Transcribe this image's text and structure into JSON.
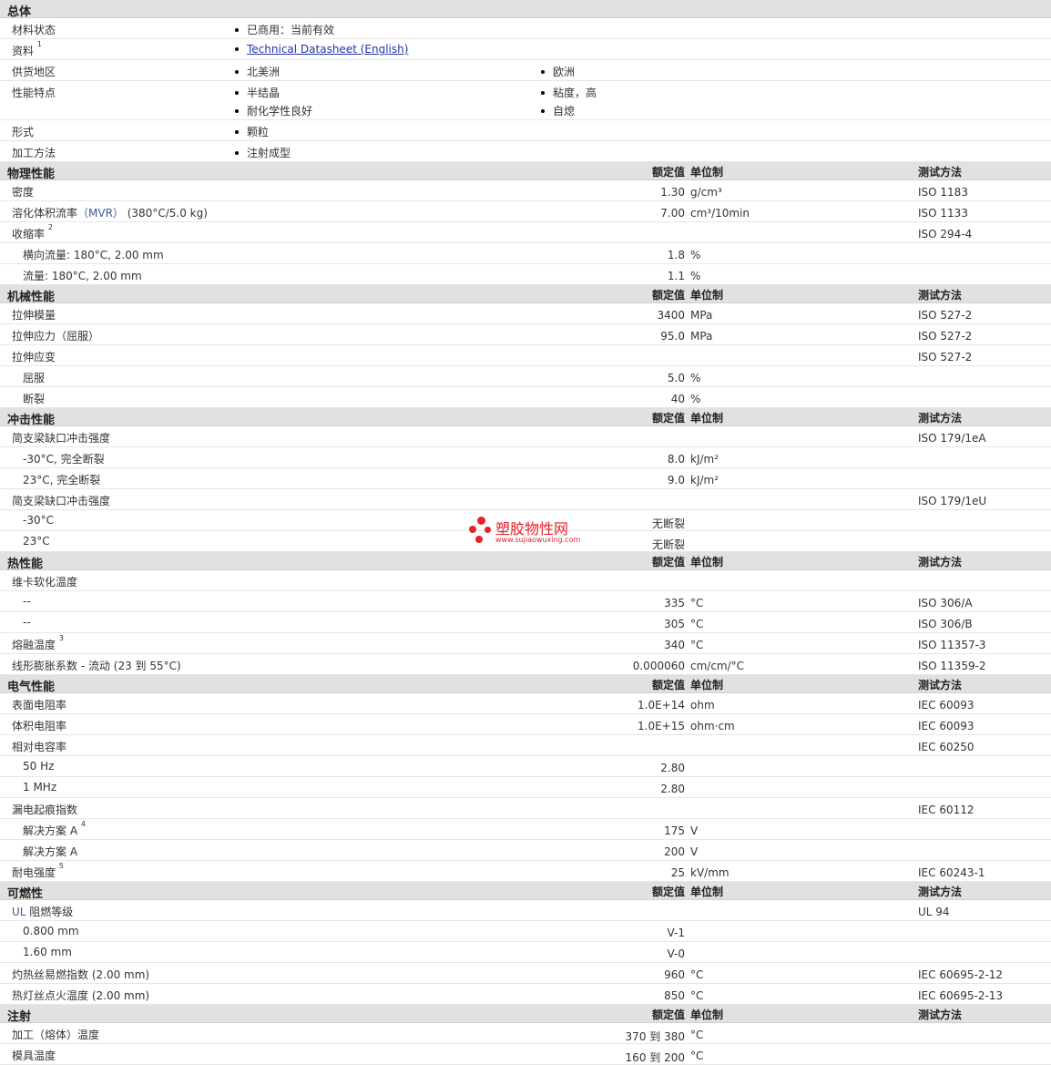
{
  "general": {
    "title": "总体",
    "rows": [
      {
        "label": "材料状态",
        "items": [
          {
            "text": "已商用：当前有效"
          }
        ]
      },
      {
        "label": "资料",
        "sup": "1",
        "items": [
          {
            "text": "Technical Datasheet (English)",
            "link": true
          }
        ]
      },
      {
        "label": "供货地区",
        "items": [
          {
            "text": "北美洲"
          },
          {
            "text": "欧洲"
          }
        ]
      },
      {
        "label": "性能特点",
        "items": [
          {
            "text": "半结晶"
          },
          {
            "text": "粘度，高"
          },
          {
            "text": "耐化学性良好"
          },
          {
            "text": "自熄"
          }
        ]
      },
      {
        "label": "形式",
        "items": [
          {
            "text": "颗粒"
          }
        ]
      },
      {
        "label": "加工方法",
        "items": [
          {
            "text": "注射成型"
          }
        ]
      }
    ]
  },
  "columns": {
    "nominal": "额定值",
    "unit": "单位制",
    "test": "测试方法"
  },
  "sections": [
    {
      "title": "物理性能",
      "rows": [
        {
          "label": "密度",
          "value": "1.30",
          "unit": "g/cm³",
          "test": "ISO 1183"
        },
        {
          "label": "溶化体积流率",
          "accent": "（MVR）",
          "cond": " (380°C/5.0 kg)",
          "value": "7.00",
          "unit": "cm³/10min",
          "test": "ISO 1133"
        },
        {
          "label": "收缩率",
          "sup": "2",
          "test": "ISO 294-4"
        },
        {
          "label": "横向流量: 180°C, 2.00 mm",
          "sub": true,
          "value": "1.8",
          "unit": "%"
        },
        {
          "label": "流量: 180°C, 2.00 mm",
          "sub": true,
          "value": "1.1",
          "unit": "%"
        }
      ]
    },
    {
      "title": "机械性能",
      "rows": [
        {
          "label": "拉伸模量",
          "value": "3400",
          "unit": "MPa",
          "test": "ISO 527-2"
        },
        {
          "label": "拉伸应力（屈服）",
          "value": "95.0",
          "unit": "MPa",
          "test": "ISO 527-2"
        },
        {
          "label": "拉伸应变",
          "test": "ISO 527-2"
        },
        {
          "label": "屈服",
          "sub": true,
          "value": "5.0",
          "unit": "%"
        },
        {
          "label": "断裂",
          "sub": true,
          "value": "40",
          "unit": "%"
        }
      ]
    },
    {
      "title": "冲击性能",
      "rows": [
        {
          "label": "简支梁缺口冲击强度",
          "test": "ISO 179/1eA"
        },
        {
          "label": "-30°C, 完全断裂",
          "sub": true,
          "value": "8.0",
          "unit": "kJ/m²"
        },
        {
          "label": "23°C, 完全断裂",
          "sub": true,
          "value": "9.0",
          "unit": "kJ/m²"
        },
        {
          "label": "简支梁缺口冲击强度",
          "test": "ISO 179/1eU"
        },
        {
          "label": "-30°C",
          "sub": true,
          "value": "无断裂"
        },
        {
          "label": "23°C",
          "sub": true,
          "value": "无断裂"
        }
      ]
    },
    {
      "title": "热性能",
      "rows": [
        {
          "label": "维卡软化温度"
        },
        {
          "label": "--",
          "sub": true,
          "value": "335",
          "unit": "°C",
          "test": "ISO 306/A"
        },
        {
          "label": "--",
          "sub": true,
          "value": "305",
          "unit": "°C",
          "test": "ISO 306/B"
        },
        {
          "label": "熔融温度",
          "sup": "3",
          "value": "340",
          "unit": "°C",
          "test": "ISO 11357-3"
        },
        {
          "label": "线形膨胀系数 - 流动 (23 到 55°C)",
          "value": "0.000060",
          "unit": "cm/cm/°C",
          "test": "ISO 11359-2"
        }
      ]
    },
    {
      "title": "电气性能",
      "rows": [
        {
          "label": "表面电阻率",
          "value": "1.0E+14",
          "unit": "ohm",
          "test": "IEC 60093"
        },
        {
          "label": "体积电阻率",
          "value": "1.0E+15",
          "unit": "ohm·cm",
          "test": "IEC 60093"
        },
        {
          "label": "相对电容率",
          "test": "IEC 60250"
        },
        {
          "label": "50 Hz",
          "sub": true,
          "value": "2.80"
        },
        {
          "label": "1 MHz",
          "sub": true,
          "value": "2.80"
        },
        {
          "label": "漏电起痕指数",
          "test": "IEC 60112"
        },
        {
          "label": "解决方案 A",
          "sup": "4",
          "sub": true,
          "value": "175",
          "unit": "V"
        },
        {
          "label": "解决方案 A",
          "sub": true,
          "value": "200",
          "unit": "V"
        },
        {
          "label": "耐电强度",
          "sup": "5",
          "value": "25",
          "unit": "kV/mm",
          "test": "IEC 60243-1"
        }
      ]
    },
    {
      "title": "可燃性",
      "rows": [
        {
          "label": "",
          "accent": "UL",
          "cond": " 阻燃等级",
          "test": "UL 94"
        },
        {
          "label": "0.800 mm",
          "sub": true,
          "value": "V-1"
        },
        {
          "label": "1.60 mm",
          "sub": true,
          "value": "V-0"
        },
        {
          "label": "灼热丝易燃指数 (2.00 mm)",
          "value": "960",
          "unit": "°C",
          "test": "IEC 60695-2-12"
        },
        {
          "label": "热灯丝点火温度 (2.00 mm)",
          "value": "850",
          "unit": "°C",
          "test": "IEC 60695-2-13"
        }
      ]
    },
    {
      "title": "注射",
      "rows": [
        {
          "label": "加工（熔体）温度",
          "value": "370 到 380",
          "unit": "°C"
        },
        {
          "label": "模具温度",
          "value": "160 到 200",
          "unit": "°C"
        }
      ]
    }
  ],
  "watermark": {
    "name": "塑胶物性网",
    "url": "www.sujiaowuxing.com"
  }
}
